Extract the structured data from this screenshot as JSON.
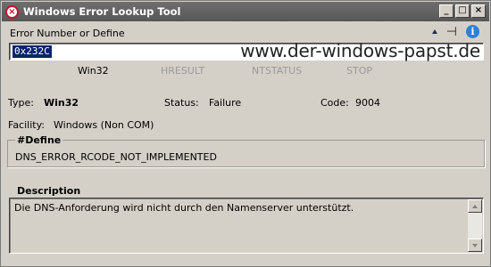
{
  "window": {
    "title": "Windows Error Lookup Tool",
    "minimize": "_",
    "maximize": "□",
    "close": "×"
  },
  "input": {
    "label": "Error Number or Define",
    "value": "0x232C"
  },
  "watermark": "www.der-windows-papst.de",
  "toolbar_icons": [
    "up-arrow-icon",
    "pin-icon",
    "info-icon"
  ],
  "tabs": [
    {
      "label": "Win32",
      "state": "active"
    },
    {
      "label": "HRESULT",
      "state": "disabled"
    },
    {
      "label": "NTSTATUS",
      "state": "disabled"
    },
    {
      "label": "STOP",
      "state": "disabled"
    }
  ],
  "details": {
    "type_label": "Type:",
    "type_value": "Win32",
    "status_label": "Status:",
    "status_value": "Failure",
    "code_label": "Code:",
    "code_value": "9004",
    "facility_label": "Facility:",
    "facility_value": "Windows (Non COM)"
  },
  "define": {
    "title": "#Define",
    "value": "DNS_ERROR_RCODE_NOT_IMPLEMENTED"
  },
  "description": {
    "title": "Description",
    "text": "Die DNS-Anforderung wird nicht durch den Namenserver unterstützt."
  },
  "colors": {
    "titlebar": "#575757",
    "selection": "#0a246a",
    "close_icon_red": "#c8102e",
    "info_blue": "#2d7fd8",
    "disabled_text": "#9a9a9a"
  }
}
